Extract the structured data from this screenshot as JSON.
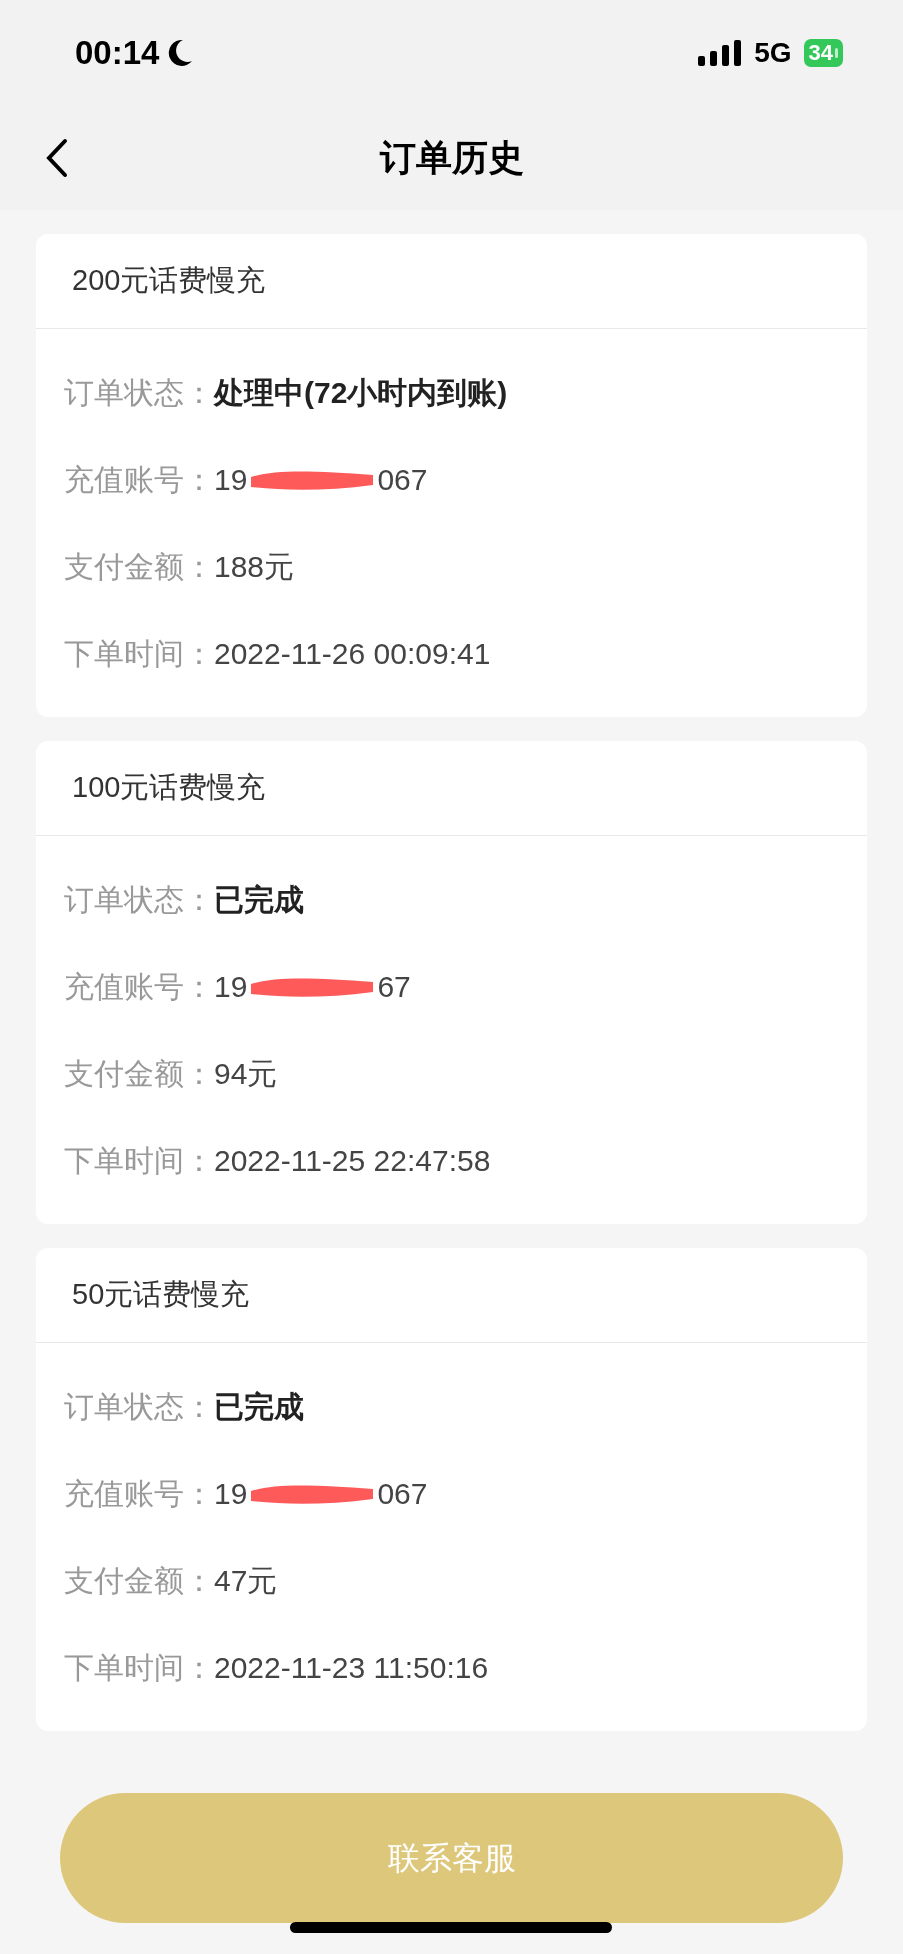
{
  "status_bar": {
    "time": "00:14",
    "network": "5G",
    "battery": "34"
  },
  "nav": {
    "title": "订单历史"
  },
  "orders": [
    {
      "title": "200元话费慢充",
      "rows": [
        {
          "kind": "status",
          "label": "订单状态：",
          "value": "处理中(72小时内到账)"
        },
        {
          "kind": "account",
          "label": "充值账号：",
          "prefix": "19",
          "suffix": "067"
        },
        {
          "kind": "text",
          "label": "支付金额：",
          "value": "188元"
        },
        {
          "kind": "text",
          "label": "下单时间：",
          "value": "2022-11-26 00:09:41"
        }
      ]
    },
    {
      "title": "100元话费慢充",
      "rows": [
        {
          "kind": "status",
          "label": "订单状态：",
          "value": "已完成"
        },
        {
          "kind": "account",
          "label": "充值账号：",
          "prefix": "19",
          "suffix": "67"
        },
        {
          "kind": "text",
          "label": "支付金额：",
          "value": "94元"
        },
        {
          "kind": "text",
          "label": "下单时间：",
          "value": "2022-11-25 22:47:58"
        }
      ]
    },
    {
      "title": "50元话费慢充",
      "rows": [
        {
          "kind": "status",
          "label": "订单状态：",
          "value": "已完成"
        },
        {
          "kind": "account",
          "label": "充值账号：",
          "prefix": "19",
          "suffix": "067"
        },
        {
          "kind": "text",
          "label": "支付金额：",
          "value": "47元"
        },
        {
          "kind": "text",
          "label": "下单时间：",
          "value": "2022-11-23 11:50:16"
        }
      ]
    }
  ],
  "contact_button": {
    "label": "联系客服"
  }
}
